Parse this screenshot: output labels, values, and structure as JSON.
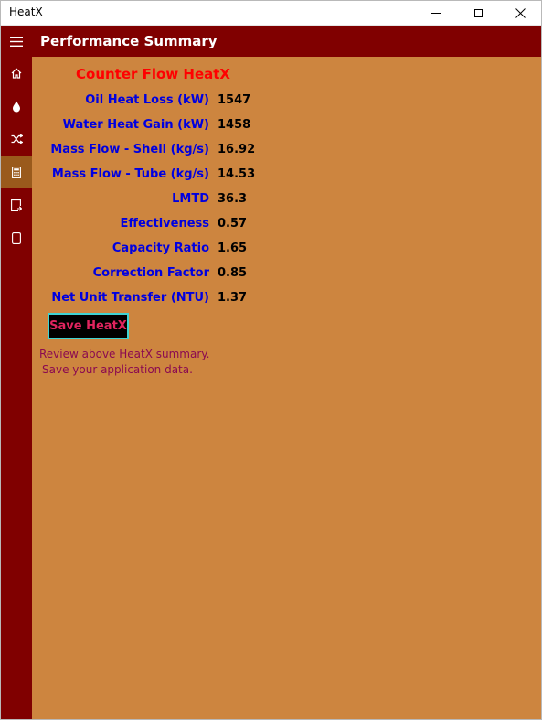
{
  "window": {
    "title": "HeatX"
  },
  "header": {
    "title": "Performance Summary"
  },
  "nav": {
    "items": [
      "home-icon",
      "droplet-icon",
      "shuffle-icon",
      "calculator-icon",
      "report-icon",
      "device-icon"
    ],
    "selected": 3
  },
  "summary": {
    "title": "Counter Flow HeatX",
    "rows": [
      {
        "label": "Oil Heat Loss (kW)",
        "value": "1547"
      },
      {
        "label": "Water Heat Gain (kW)",
        "value": "1458"
      },
      {
        "label": "Mass Flow - Shell (kg/s)",
        "value": "16.92"
      },
      {
        "label": "Mass Flow - Tube (kg/s)",
        "value": "14.53"
      },
      {
        "label": "LMTD",
        "value": "36.3"
      },
      {
        "label": "Effectiveness",
        "value": "0.57"
      },
      {
        "label": "Capacity Ratio",
        "value": "1.65"
      },
      {
        "label": "Correction Factor",
        "value": "0.85"
      },
      {
        "label": "Net Unit Transfer (NTU)",
        "value": "1.37"
      }
    ],
    "save_label": "Save HeatX",
    "message_line1": "Review above HeatX summary.",
    "message_line2": "Save your application data."
  },
  "colors": {
    "background": "#cd853f",
    "bar": "#800000",
    "label": "#0000e0",
    "title": "#ff0000",
    "button_border": "#3ed3d3",
    "button_text": "#e0245e",
    "message": "#8b0a50"
  }
}
